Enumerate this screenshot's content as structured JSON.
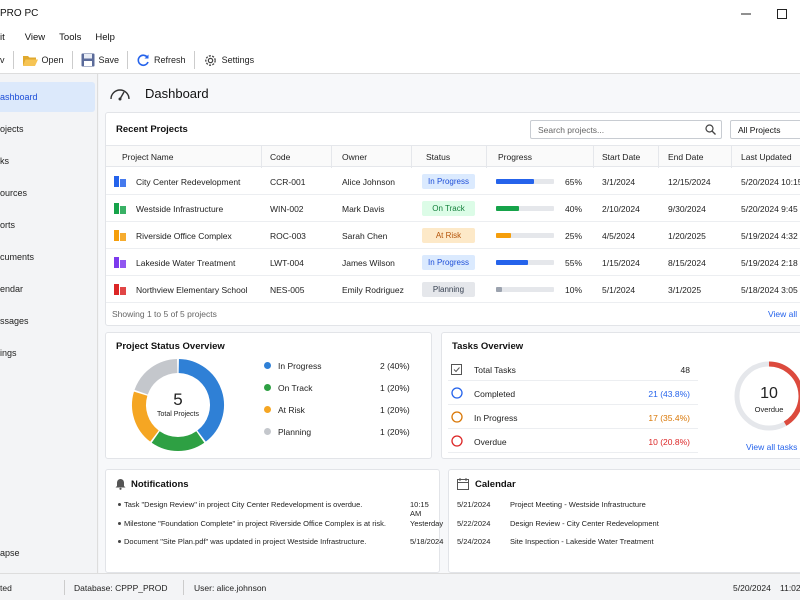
{
  "window": {
    "title": "PRO PC",
    "maximize_glyph": "☐"
  },
  "menu": [
    "it",
    "View",
    "Tools",
    "Help"
  ],
  "toolbar": {
    "new_label": "v",
    "open_label": "Open",
    "save_label": "Save",
    "refresh_label": "Refresh",
    "settings_label": "Settings"
  },
  "sidebar": {
    "items": [
      {
        "label": "ashboard",
        "active": true
      },
      {
        "label": "ojects"
      },
      {
        "label": "ks"
      },
      {
        "label": "ources"
      },
      {
        "label": "orts"
      },
      {
        "label": "cuments"
      },
      {
        "label": "endar"
      },
      {
        "label": "ssages"
      },
      {
        "label": "ings"
      }
    ],
    "collapse_label": "apse"
  },
  "page": {
    "title": "Dashboard"
  },
  "recent_projects": {
    "title": "Recent Projects",
    "search_placeholder": "Search projects...",
    "filter_value": "All Projects",
    "columns": [
      "Project Name",
      "Code",
      "Owner",
      "Status",
      "Progress",
      "Start Date",
      "End Date",
      "Last Updated"
    ],
    "rows": [
      {
        "name": "City Center Redevelopment",
        "code": "CCR-001",
        "owner": "Alice Johnson",
        "status": "In Progress",
        "progress": 65,
        "progress_text": "65%",
        "start": "3/1/2024",
        "end": "12/15/2024",
        "updated": "5/20/2024 10:15",
        "icon": "building-icon",
        "icon_color": "#2563eb",
        "bar_color": "#2563eb"
      },
      {
        "name": "Westside Infrastructure",
        "code": "WIN-002",
        "owner": "Mark Davis",
        "status": "On Track",
        "progress": 40,
        "progress_text": "40%",
        "start": "2/10/2024",
        "end": "9/30/2024",
        "updated": "5/20/2024 9:45",
        "icon": "road-icon",
        "icon_color": "#16a34a",
        "bar_color": "#16a34a"
      },
      {
        "name": "Riverside Office Complex",
        "code": "ROC-003",
        "owner": "Sarah Chen",
        "status": "At Risk",
        "progress": 25,
        "progress_text": "25%",
        "start": "4/5/2024",
        "end": "1/20/2025",
        "updated": "5/19/2024 4:32",
        "icon": "office-icon",
        "icon_color": "#f59e0b",
        "bar_color": "#f59e0b"
      },
      {
        "name": "Lakeside Water Treatment",
        "code": "LWT-004",
        "owner": "James Wilson",
        "status": "In Progress",
        "progress": 55,
        "progress_text": "55%",
        "start": "1/15/2024",
        "end": "8/15/2024",
        "updated": "5/19/2024 2:18",
        "icon": "water-drop-icon",
        "icon_color": "#7c3aed",
        "bar_color": "#2563eb"
      },
      {
        "name": "Northview Elementary School",
        "code": "NES-005",
        "owner": "Emily Rodriguez",
        "status": "Planning",
        "progress": 10,
        "progress_text": "10%",
        "start": "5/1/2024",
        "end": "3/1/2025",
        "updated": "5/18/2024 3:05",
        "icon": "school-icon",
        "icon_color": "#dc2626",
        "bar_color": "#9ca3af"
      }
    ],
    "showing_text": "Showing 1 to 5 of 5 projects",
    "view_all": "View all"
  },
  "status_overview": {
    "title": "Project Status Overview",
    "total": "5",
    "total_label": "Total Projects",
    "legend": [
      {
        "label": "In Progress",
        "value": "2 (40%)",
        "color": "#2f80d6",
        "count": 2
      },
      {
        "label": "On Track",
        "value": "1 (20%)",
        "color": "#2ea043",
        "count": 1
      },
      {
        "label": "At Risk",
        "value": "1 (20%)",
        "color": "#f5a623",
        "count": 1
      },
      {
        "label": "Planning",
        "value": "1 (20%)",
        "color": "#c4c7cc",
        "count": 1
      }
    ]
  },
  "tasks_overview": {
    "title": "Tasks Overview",
    "rows": [
      {
        "label": "Total Tasks",
        "value": "48",
        "color": "#222222",
        "icon": "clipboard-icon"
      },
      {
        "label": "Completed",
        "value": "21 (43.8%)",
        "color": "#2563eb",
        "icon": "circle-icon"
      },
      {
        "label": "In Progress",
        "value": "17 (35.4%)",
        "color": "#d97706",
        "icon": "circle-icon"
      },
      {
        "label": "Overdue",
        "value": "10 (20.8%)",
        "color": "#dc2626",
        "icon": "circle-icon"
      }
    ],
    "overdue_count": "10",
    "overdue_label": "Overdue",
    "overdue_fraction": 0.208,
    "view_all": "View all tasks"
  },
  "notifications": {
    "title": "Notifications",
    "items": [
      {
        "text": "Task \"Design Review\" in project City Center Redevelopment is overdue.",
        "time": "10:15 AM"
      },
      {
        "text": "Milestone \"Foundation Complete\" in project Riverside Office Complex is at risk.",
        "time": "Yesterday"
      },
      {
        "text": "Document \"Site Plan.pdf\" was updated in project Westside Infrastructure.",
        "time": "5/18/2024"
      }
    ]
  },
  "calendar": {
    "title": "Calendar",
    "items": [
      {
        "date": "5/21/2024",
        "event": "Project Meeting - Westside Infrastructure"
      },
      {
        "date": "5/22/2024",
        "event": "Design Review - City Center Redevelopment"
      },
      {
        "date": "5/24/2024",
        "event": "Site Inspection - Lakeside Water Treatment"
      }
    ]
  },
  "statusbar": {
    "status": "ted",
    "database": "Database: CPPP_PROD",
    "user": "User: alice.johnson",
    "date": "5/20/2024",
    "time": "11:02"
  },
  "badge_colors": {
    "In Progress": {
      "bg": "#dbeafe",
      "fg": "#1d4ed8"
    },
    "On Track": {
      "bg": "#dcfce7",
      "fg": "#15803d"
    },
    "At Risk": {
      "bg": "#fde9c8",
      "fg": "#b45309"
    },
    "Planning": {
      "bg": "#e5e7eb",
      "fg": "#374151"
    }
  }
}
